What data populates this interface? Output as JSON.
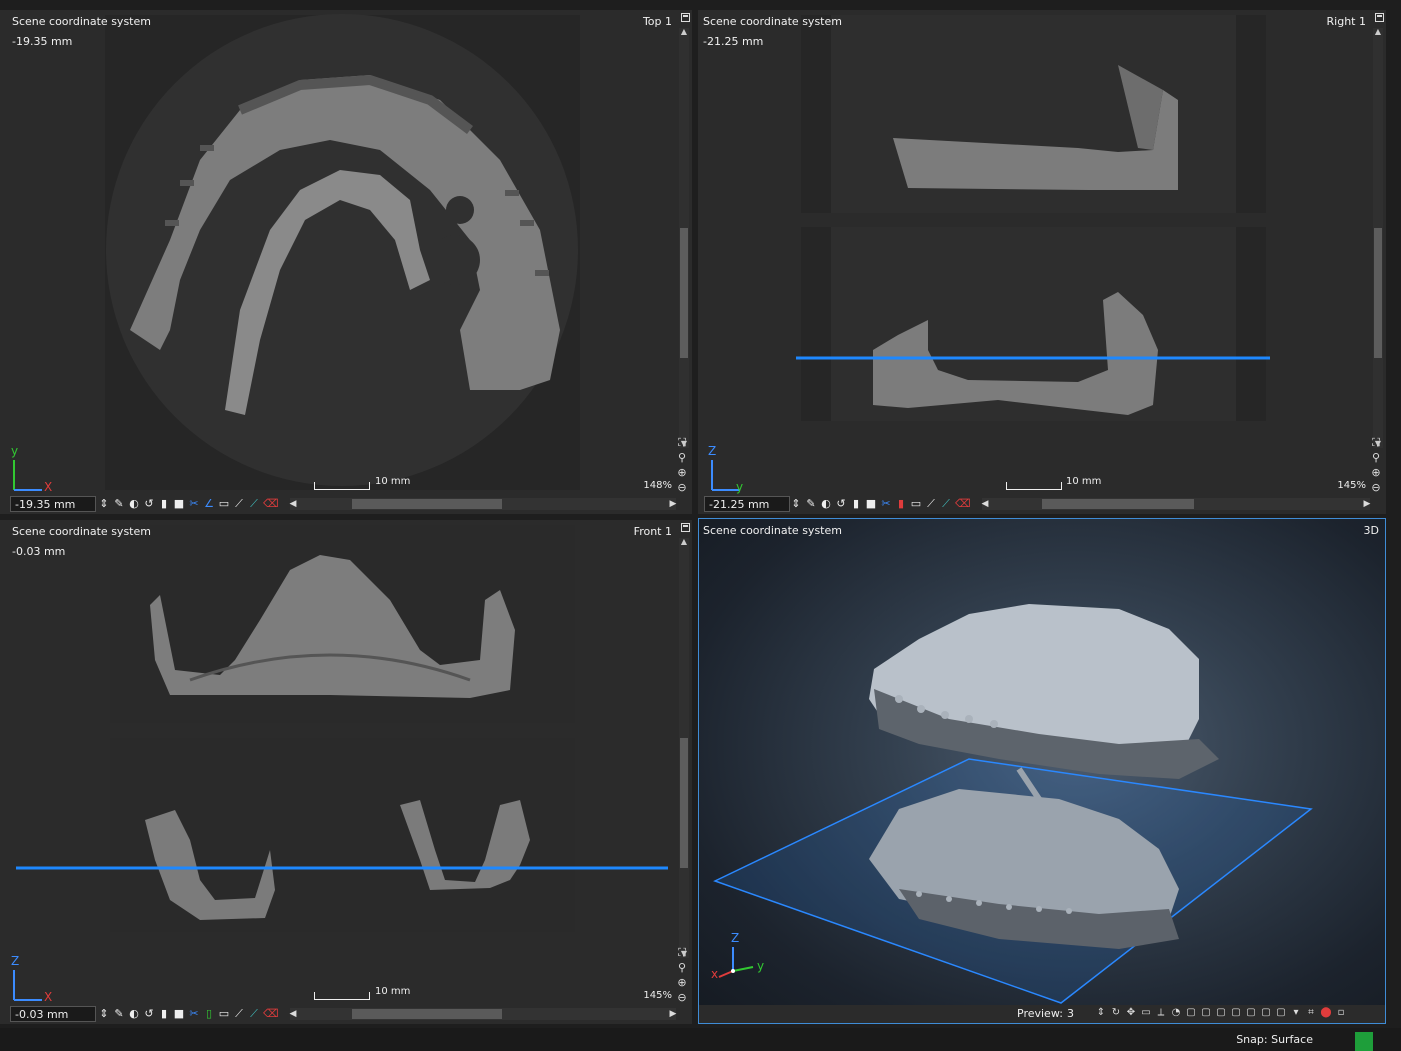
{
  "views": {
    "top": {
      "coord_system": "Scene coordinate system",
      "depth": "-19.35 mm",
      "name": "Top 1",
      "zoom": "148%",
      "scale_label": "10 mm",
      "position_value": "-19.35 mm",
      "axis_up": "y",
      "axis_right": "X"
    },
    "right": {
      "coord_system": "Scene coordinate system",
      "depth": "-21.25 mm",
      "name": "Right 1",
      "zoom": "145%",
      "scale_label": "10 mm",
      "position_value": "-21.25 mm",
      "axis_up": "Z",
      "axis_right": "y"
    },
    "front": {
      "coord_system": "Scene coordinate system",
      "depth": "-0.03 mm",
      "name": "Front 1",
      "zoom": "145%",
      "scale_label": "10 mm",
      "position_value": "-0.03 mm",
      "axis_up": "Z",
      "axis_right": "X"
    },
    "three_d": {
      "coord_system": "Scene coordinate system",
      "name": "3D",
      "preview_label": "Preview:",
      "preview_value": "3",
      "axis_up": "Z",
      "axis_right": "y",
      "axis_left": "x"
    }
  },
  "status": {
    "snap": "Snap: Surface"
  },
  "colors": {
    "accent_blue": "#3f8cd6",
    "slice_line": "#1e88ff",
    "axis_green": "#32c832",
    "axis_red": "#e03c3c",
    "axis_blue": "#3c8cff"
  },
  "icons": [
    "pin-icon",
    "zoom-fit-icon",
    "zoom-icon",
    "zoom-in-icon",
    "zoom-out-icon",
    "pen-icon",
    "contrast-icon",
    "reset-icon",
    "scissors-icon",
    "ruler-icon",
    "eraser-icon"
  ]
}
